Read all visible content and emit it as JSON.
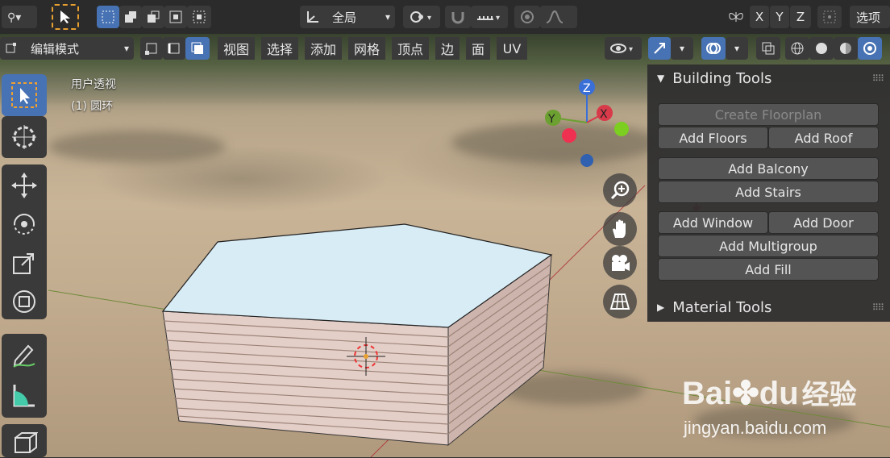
{
  "header": {
    "transform_orientation": "全局",
    "axes": [
      "X",
      "Y",
      "Z"
    ],
    "options_label": "选项"
  },
  "mode_bar": {
    "mode": "编辑模式",
    "menus": [
      "视图",
      "选择",
      "添加",
      "网格",
      "顶点",
      "边",
      "面",
      "UV"
    ]
  },
  "viewport": {
    "view_name": "用户透视",
    "object_label": "(1) 圆环",
    "gizmo_axes": {
      "z": "Z",
      "x": "X",
      "y": "Y"
    }
  },
  "panel": {
    "building_tools": {
      "title": "Building Tools",
      "create_floorplan": "Create Floorplan",
      "add_floors": "Add Floors",
      "add_roof": "Add Roof",
      "add_balcony": "Add Balcony",
      "add_stairs": "Add Stairs",
      "add_window": "Add Window",
      "add_door": "Add Door",
      "add_multigroup": "Add Multigroup",
      "add_fill": "Add Fill"
    },
    "material_tools": {
      "title": "Material Tools"
    }
  },
  "watermark": {
    "brand": "Bai",
    "brand2": "du",
    "cn": "经验",
    "url": "jingyan.baidu.com"
  },
  "colors": {
    "accent": "#4772b3",
    "panel_bg": "#303030",
    "button_bg": "#545454",
    "arrow_red": "#e0211a"
  }
}
